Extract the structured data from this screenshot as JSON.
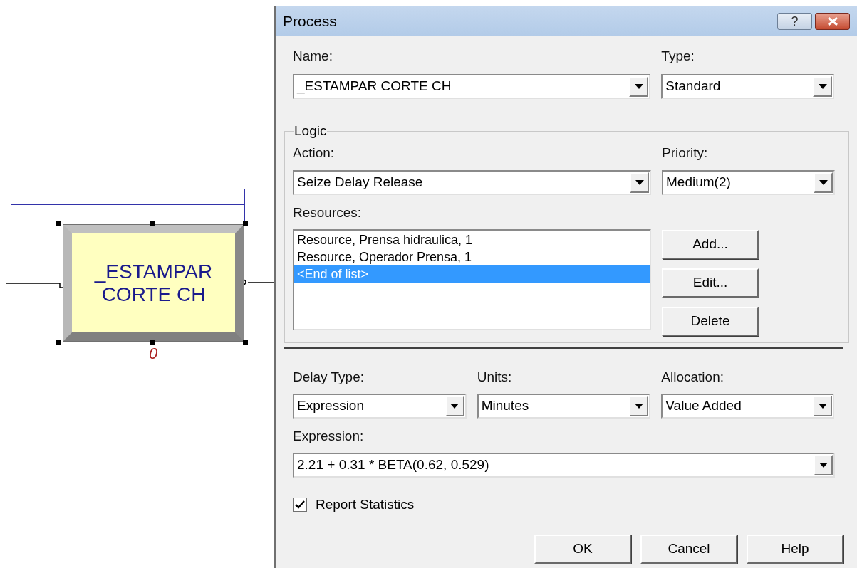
{
  "diagram": {
    "module": {
      "label": "_ESTAMPAR CORTE CH",
      "count": "0",
      "selected": true
    }
  },
  "dialog": {
    "title": "Process",
    "help_glyph": "?",
    "name": {
      "label": "Name:",
      "value": "_ESTAMPAR CORTE CH"
    },
    "type": {
      "label": "Type:",
      "value": "Standard"
    },
    "logic": {
      "title": "Logic",
      "action": {
        "label": "Action:",
        "value": "Seize Delay Release"
      },
      "priority": {
        "label": "Priority:",
        "value": "Medium(2)"
      },
      "resources": {
        "label": "Resources:",
        "items": [
          {
            "text": "Resource, Prensa hidraulica, 1",
            "selected": false
          },
          {
            "text": "Resource, Operador Prensa, 1",
            "selected": false
          },
          {
            "text": "<End of list>",
            "selected": true
          }
        ]
      },
      "buttons": [
        "Add...",
        "Edit...",
        "Delete"
      ]
    },
    "delay_type": {
      "label": "Delay Type:",
      "value": "Expression"
    },
    "units": {
      "label": "Units:",
      "value": "Minutes"
    },
    "allocation": {
      "label": "Allocation:",
      "value": "Value Added"
    },
    "expression": {
      "label": "Expression:",
      "value": "2.21 + 0.31 * BETA(0.62, 0.529)"
    },
    "report_statistics": {
      "label": "Report Statistics",
      "checked": true
    },
    "buttons": [
      "OK",
      "Cancel",
      "Help"
    ]
  }
}
